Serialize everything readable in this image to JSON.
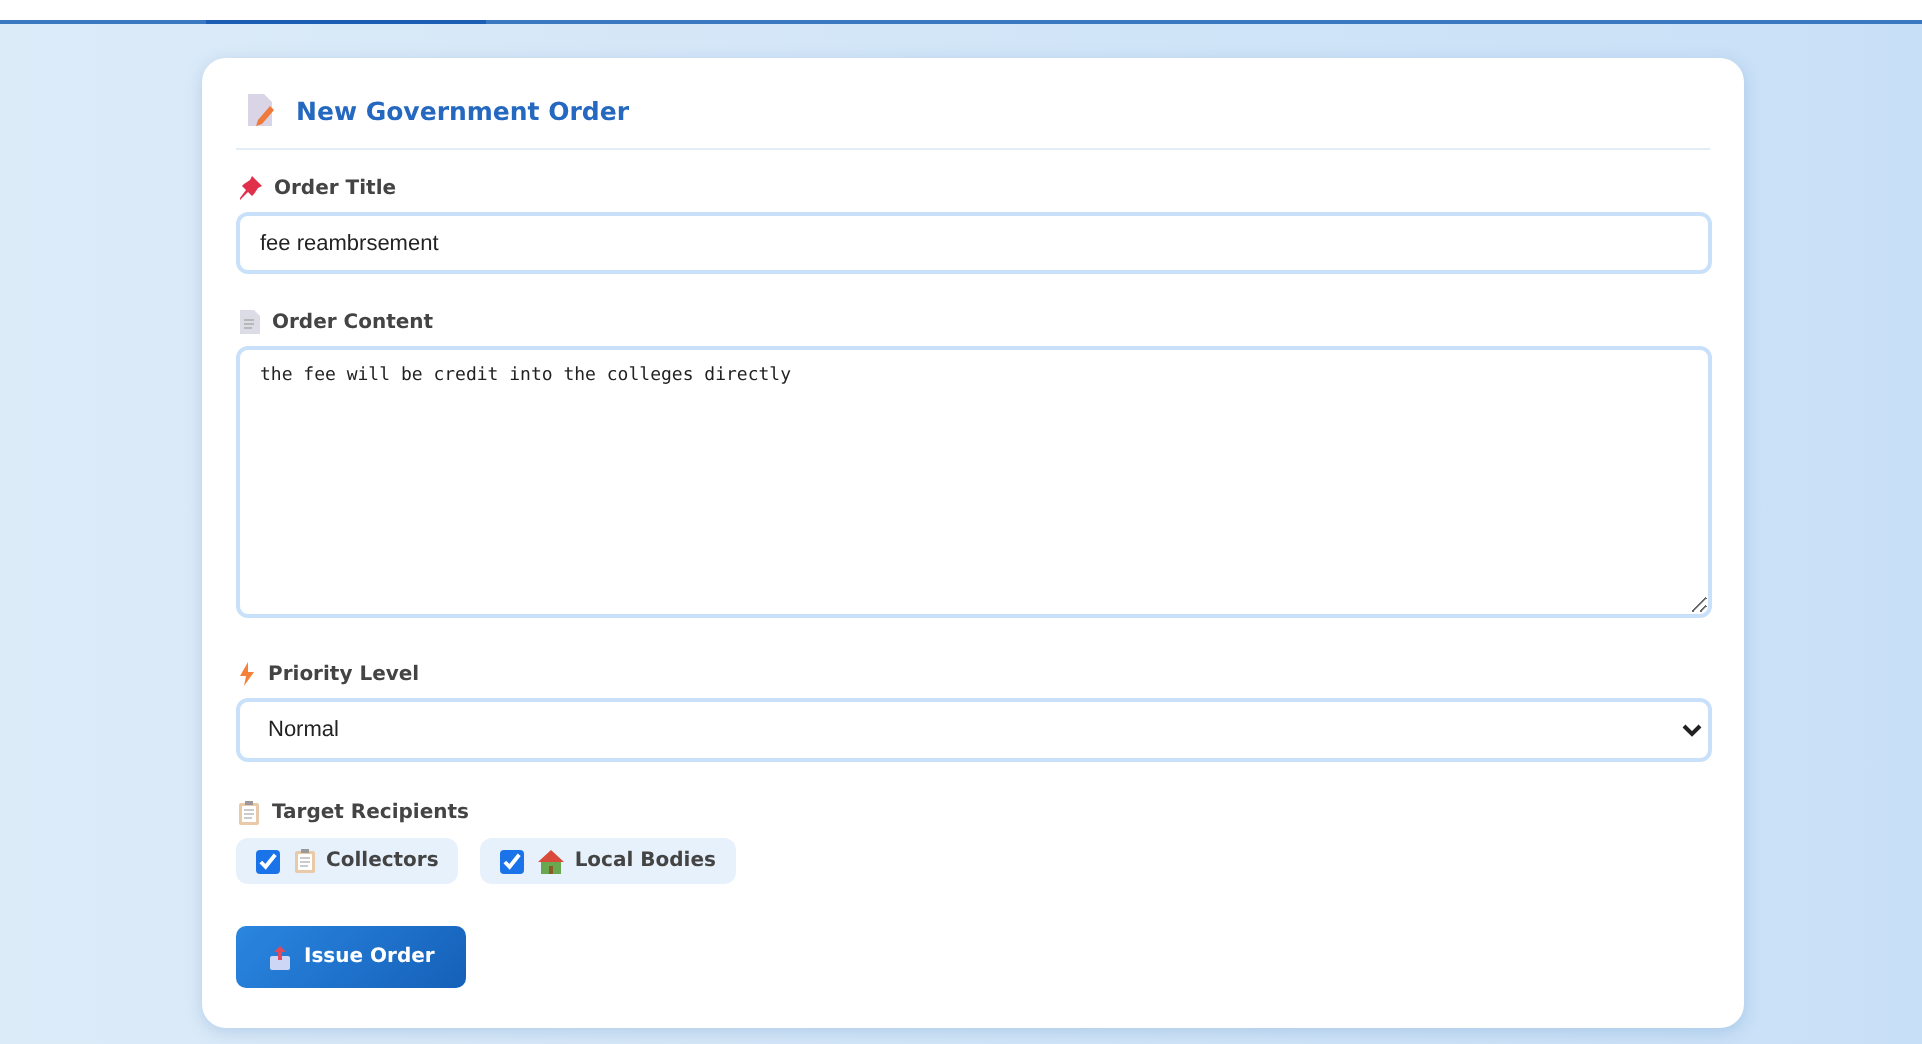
{
  "form": {
    "title": "New Government Order",
    "order_title": {
      "label": "Order Title",
      "value": "fee reambrsement"
    },
    "order_content": {
      "label": "Order Content",
      "value": "the fee will be credit into the colleges directly"
    },
    "priority": {
      "label": "Priority Level",
      "value": "Normal"
    },
    "recipients": {
      "label": "Target Recipients",
      "options": [
        {
          "label": "Collectors",
          "kind": "clipboard",
          "checked": true
        },
        {
          "label": "Local Bodies",
          "kind": "house",
          "checked": true
        }
      ]
    },
    "submit": {
      "label": "Issue Order"
    }
  }
}
